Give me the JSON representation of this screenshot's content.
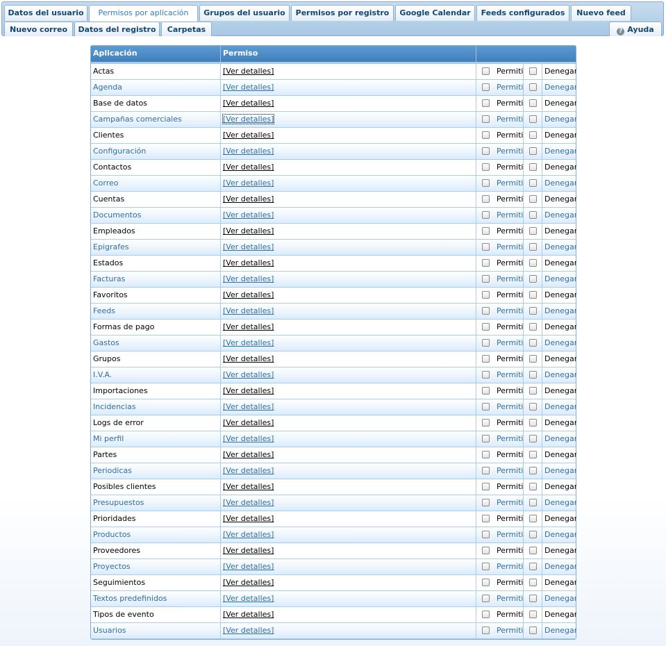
{
  "tabs_row1": [
    {
      "label": "Datos del usuario",
      "active": false
    },
    {
      "label": "Permisos por aplicación",
      "active": true
    },
    {
      "label": "Grupos del usuario",
      "active": false
    },
    {
      "label": "Permisos por registro",
      "active": false
    },
    {
      "label": "Google Calendar",
      "active": false
    },
    {
      "label": "Feeds configurados",
      "active": false
    },
    {
      "label": "Nuevo feed",
      "active": false
    }
  ],
  "tabs_row2": [
    {
      "label": "Nuevo correo"
    },
    {
      "label": "Datos del registro"
    },
    {
      "label": "Carpetas"
    }
  ],
  "help": {
    "label": "Ayuda",
    "icon": "help-circle-icon"
  },
  "grid": {
    "header": {
      "app": "Aplicación",
      "perm": "Permiso",
      "actions": ""
    },
    "details_label": "[Ver detalles]",
    "allow_label": "Permitir",
    "deny_label": "Denegar",
    "rows": [
      "Actas",
      "Agenda",
      "Base de datos",
      "Campañas comerciales",
      "Clientes",
      "Configuración",
      "Contactos",
      "Correo",
      "Cuentas",
      "Documentos",
      "Empleados",
      "Epigrafes",
      "Estados",
      "Facturas",
      "Favoritos",
      "Feeds",
      "Formas de pago",
      "Gastos",
      "Grupos",
      "I.V.A.",
      "Importaciones",
      "Incidencias",
      "Logs de error",
      "Mi perfil",
      "Partes",
      "Periodicas",
      "Posibles clientes",
      "Presupuestos",
      "Prioridades",
      "Productos",
      "Proveedores",
      "Proyectos",
      "Seguimientos",
      "Textos predefinidos",
      "Tipos de evento",
      "Usuarios"
    ]
  },
  "colors": {
    "accent": "#3f7fbb",
    "tab_text": "#15466e",
    "alt_row_text": "#2f6ea6"
  }
}
